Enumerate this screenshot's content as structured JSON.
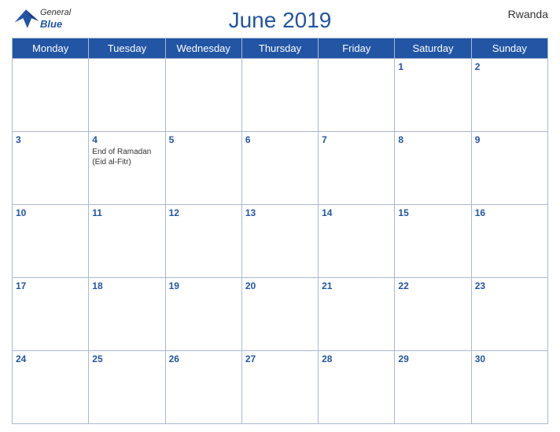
{
  "header": {
    "title": "June 2019",
    "country": "Rwanda",
    "logo": {
      "general": "General",
      "blue": "Blue"
    }
  },
  "weekdays": [
    "Monday",
    "Tuesday",
    "Wednesday",
    "Thursday",
    "Friday",
    "Saturday",
    "Sunday"
  ],
  "weeks": [
    [
      {
        "day": "",
        "holiday": ""
      },
      {
        "day": "",
        "holiday": ""
      },
      {
        "day": "",
        "holiday": ""
      },
      {
        "day": "",
        "holiday": ""
      },
      {
        "day": "",
        "holiday": ""
      },
      {
        "day": "1",
        "holiday": ""
      },
      {
        "day": "2",
        "holiday": ""
      }
    ],
    [
      {
        "day": "3",
        "holiday": ""
      },
      {
        "day": "4",
        "holiday": "End of Ramadan (Eid al-Fitr)"
      },
      {
        "day": "5",
        "holiday": ""
      },
      {
        "day": "6",
        "holiday": ""
      },
      {
        "day": "7",
        "holiday": ""
      },
      {
        "day": "8",
        "holiday": ""
      },
      {
        "day": "9",
        "holiday": ""
      }
    ],
    [
      {
        "day": "10",
        "holiday": ""
      },
      {
        "day": "11",
        "holiday": ""
      },
      {
        "day": "12",
        "holiday": ""
      },
      {
        "day": "13",
        "holiday": ""
      },
      {
        "day": "14",
        "holiday": ""
      },
      {
        "day": "15",
        "holiday": ""
      },
      {
        "day": "16",
        "holiday": ""
      }
    ],
    [
      {
        "day": "17",
        "holiday": ""
      },
      {
        "day": "18",
        "holiday": ""
      },
      {
        "day": "19",
        "holiday": ""
      },
      {
        "day": "20",
        "holiday": ""
      },
      {
        "day": "21",
        "holiday": ""
      },
      {
        "day": "22",
        "holiday": ""
      },
      {
        "day": "23",
        "holiday": ""
      }
    ],
    [
      {
        "day": "24",
        "holiday": ""
      },
      {
        "day": "25",
        "holiday": ""
      },
      {
        "day": "26",
        "holiday": ""
      },
      {
        "day": "27",
        "holiday": ""
      },
      {
        "day": "28",
        "holiday": ""
      },
      {
        "day": "29",
        "holiday": ""
      },
      {
        "day": "30",
        "holiday": ""
      }
    ]
  ]
}
